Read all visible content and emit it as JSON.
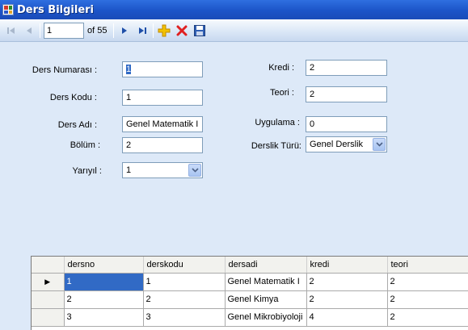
{
  "window": {
    "title": "Ders Bilgileri"
  },
  "navigator": {
    "position": "1",
    "count_label": "of 55"
  },
  "form": {
    "ders_numarasi": {
      "label": "Ders Numarası :",
      "value": "1"
    },
    "ders_kodu": {
      "label": "Ders Kodu :",
      "value": "1"
    },
    "ders_adi": {
      "label": "Ders Adı :",
      "value": "Genel Matematik I"
    },
    "bolum": {
      "label": "Bölüm :",
      "value": "2"
    },
    "yariyil": {
      "label": "Yarıyıl :",
      "value": "1"
    },
    "kredi": {
      "label": "Kredi :",
      "value": "2"
    },
    "teori": {
      "label": "Teori :",
      "value": "2"
    },
    "uygulama": {
      "label": "Uygulama :",
      "value": "0"
    },
    "derslik_turu": {
      "label": "Derslik Türü:",
      "value": "Genel Derslik"
    }
  },
  "grid": {
    "columns": [
      "dersno",
      "derskodu",
      "dersadi",
      "kredi",
      "teori"
    ],
    "rows": [
      {
        "dersno": "1",
        "derskodu": "1",
        "dersadi": "Genel Matematik I",
        "kredi": "2",
        "teori": "2"
      },
      {
        "dersno": "2",
        "derskodu": "2",
        "dersadi": "Genel Kimya",
        "kredi": "2",
        "teori": "2"
      },
      {
        "dersno": "3",
        "derskodu": "3",
        "dersadi": "Genel Mikrobiyoloji",
        "kredi": "4",
        "teori": "2"
      }
    ],
    "current_row_marker": "▶"
  },
  "colors": {
    "form_background": "#dde9f8",
    "selection": "#316ac5",
    "add_icon": "#e8b100",
    "delete_icon": "#e02020",
    "save_icon": "#2f5fb3"
  },
  "icons": {
    "first": "move-first-icon",
    "previous": "move-previous-icon",
    "next": "move-next-icon",
    "last": "move-last-icon",
    "add": "add-new-icon",
    "delete": "delete-icon",
    "save": "save-icon"
  }
}
